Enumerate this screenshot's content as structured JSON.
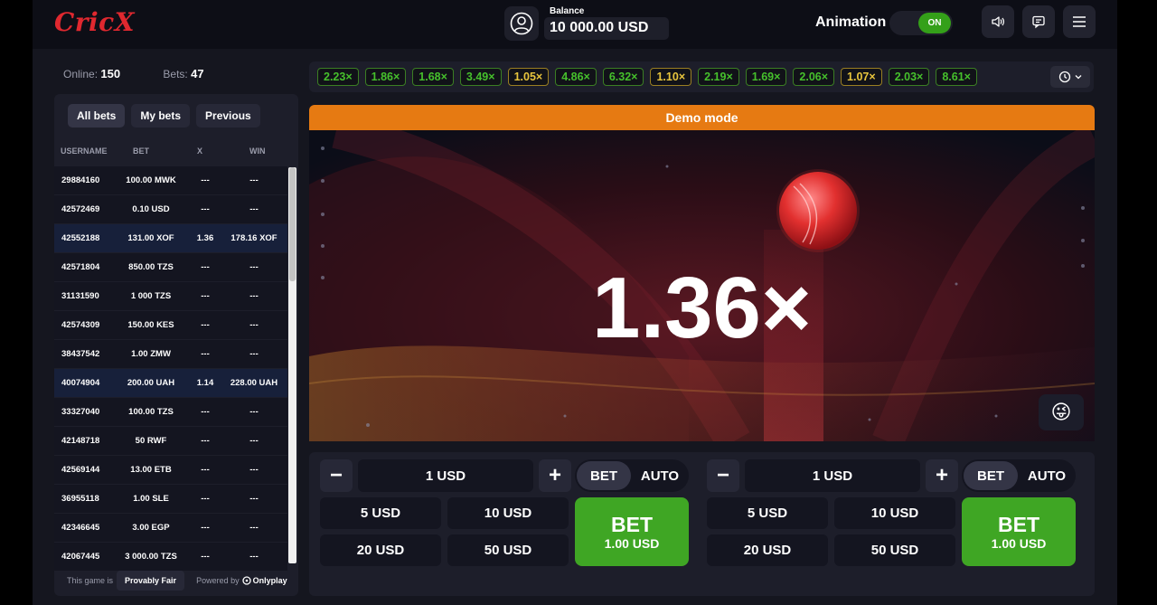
{
  "header": {
    "logo": "CricX",
    "balance_label": "Balance",
    "balance_value": "10 000.00 USD",
    "animation_label": "Animation",
    "animation_toggle": "ON"
  },
  "stats": {
    "online_label": "Online:",
    "online_value": "150",
    "bets_label": "Bets:",
    "bets_value": "47"
  },
  "bets_panel": {
    "tabs": [
      "All bets",
      "My bets",
      "Previous"
    ],
    "columns": [
      "USERNAME",
      "BET",
      "X",
      "WIN"
    ],
    "rows": [
      {
        "user": "29884160",
        "bet": "100.00 MWK",
        "x": "---",
        "win": "---"
      },
      {
        "user": "42572469",
        "bet": "0.10 USD",
        "x": "---",
        "win": "---"
      },
      {
        "user": "42552188",
        "bet": "131.00 XOF",
        "x": "1.36",
        "win": "178.16 XOF"
      },
      {
        "user": "42571804",
        "bet": "850.00 TZS",
        "x": "---",
        "win": "---"
      },
      {
        "user": "31131590",
        "bet": "1 000 TZS",
        "x": "---",
        "win": "---"
      },
      {
        "user": "42574309",
        "bet": "150.00 KES",
        "x": "---",
        "win": "---"
      },
      {
        "user": "38437542",
        "bet": "1.00 ZMW",
        "x": "---",
        "win": "---"
      },
      {
        "user": "40074904",
        "bet": "200.00 UAH",
        "x": "1.14",
        "win": "228.00 UAH"
      },
      {
        "user": "33327040",
        "bet": "100.00 TZS",
        "x": "---",
        "win": "---"
      },
      {
        "user": "42148718",
        "bet": "50 RWF",
        "x": "---",
        "win": "---"
      },
      {
        "user": "42569144",
        "bet": "13.00 ETB",
        "x": "---",
        "win": "---"
      },
      {
        "user": "36955118",
        "bet": "1.00 SLE",
        "x": "---",
        "win": "---"
      },
      {
        "user": "42346645",
        "bet": "3.00 EGP",
        "x": "---",
        "win": "---"
      },
      {
        "user": "42067445",
        "bet": "3 000.00 TZS",
        "x": "---",
        "win": "---"
      }
    ],
    "footer_prefix": "This game is",
    "provably_fair": "Provably Fair",
    "powered_by": "Powered by",
    "provider": "Onlyplay"
  },
  "history": [
    "2.23×",
    "1.86×",
    "1.68×",
    "3.49×",
    "1.05×",
    "4.86×",
    "6.32×",
    "1.10×",
    "2.19×",
    "1.69×",
    "2.06×",
    "1.07×",
    "2.03×",
    "8.61×"
  ],
  "history_low_indices": [
    4,
    7,
    11
  ],
  "game": {
    "demo_banner": "Demo mode",
    "multiplier": "1.36×",
    "emoji": "😜"
  },
  "bet_panels": [
    {
      "amount": "1 USD",
      "mode_bet": "BET",
      "mode_auto": "AUTO",
      "quick": [
        "5 USD",
        "10 USD",
        "20 USD",
        "50 USD"
      ],
      "bet_button": "BET",
      "bet_button_amount": "1.00 USD",
      "minus": "−",
      "plus": "+"
    },
    {
      "amount": "1 USD",
      "mode_bet": "BET",
      "mode_auto": "AUTO",
      "quick": [
        "5 USD",
        "10 USD",
        "20 USD",
        "50 USD"
      ],
      "bet_button": "BET",
      "bet_button_amount": "1.00 USD",
      "minus": "−",
      "plus": "+"
    }
  ],
  "colors": {
    "accent_green": "#3fa624",
    "demo_orange": "#e67a12",
    "logo_red": "#e0282f",
    "panel": "#1d1e2a",
    "low_multiplier": "#e8c53d",
    "high_multiplier": "#46c02c"
  },
  "icons": [
    "user-icon",
    "sound-icon",
    "chat-icon",
    "menu-icon",
    "history-clock-icon",
    "chevron-down-icon",
    "cricket-ball-icon",
    "emoji-icon",
    "onlyplay-logo-icon"
  ]
}
